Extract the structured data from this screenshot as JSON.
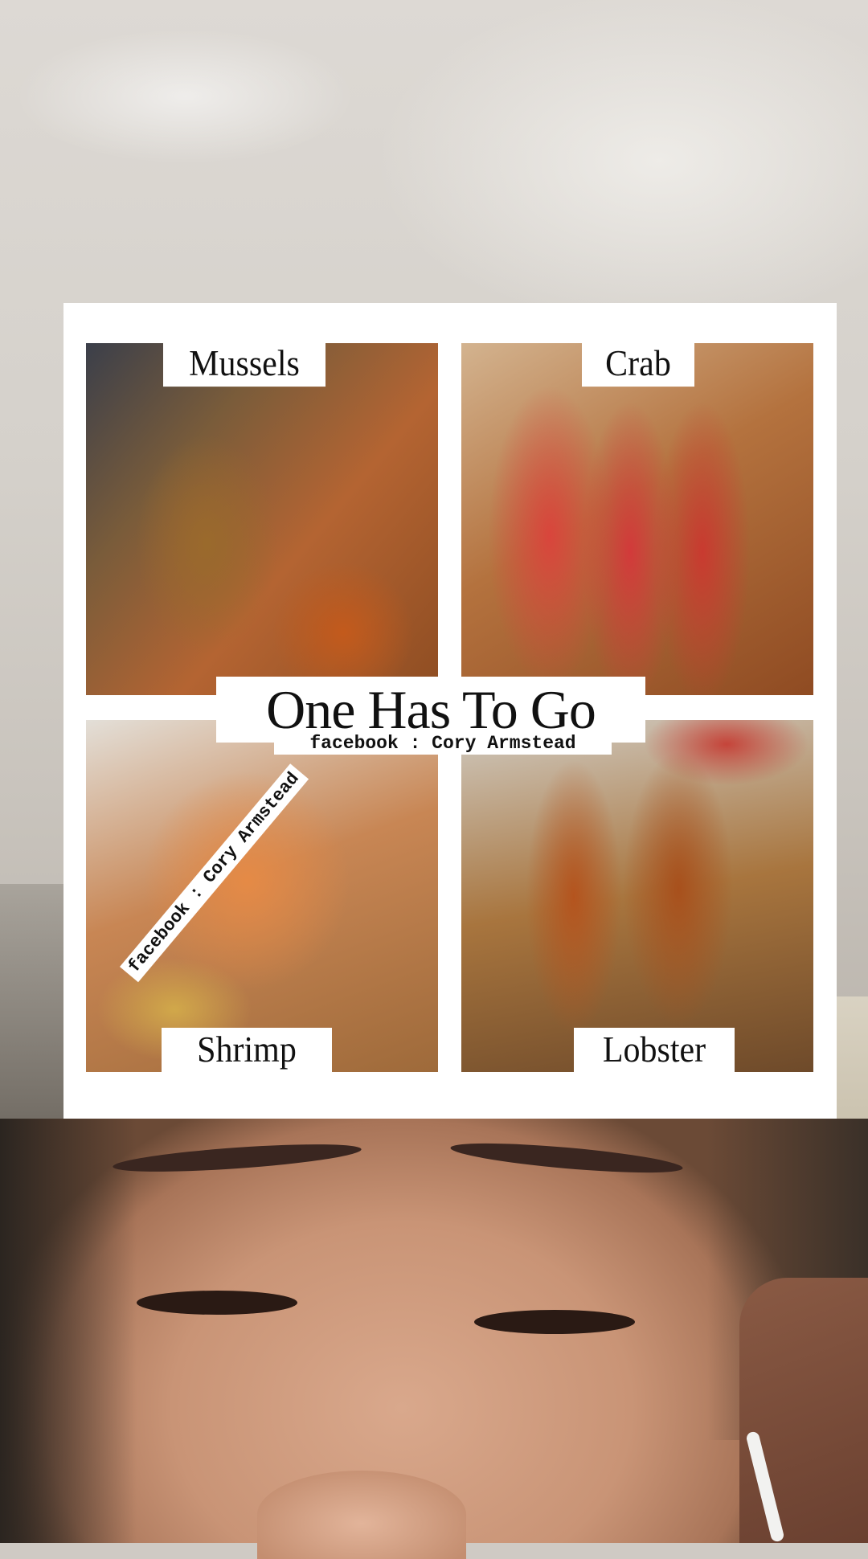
{
  "collage": {
    "labels": {
      "mussels": "Mussels",
      "crab": "Crab",
      "shrimp": "Shrimp",
      "lobster": "Lobster"
    },
    "headline": "One Has To Go",
    "credit": "facebook : Cory Armstead",
    "watermark": "facebook : Cory Armstead"
  }
}
